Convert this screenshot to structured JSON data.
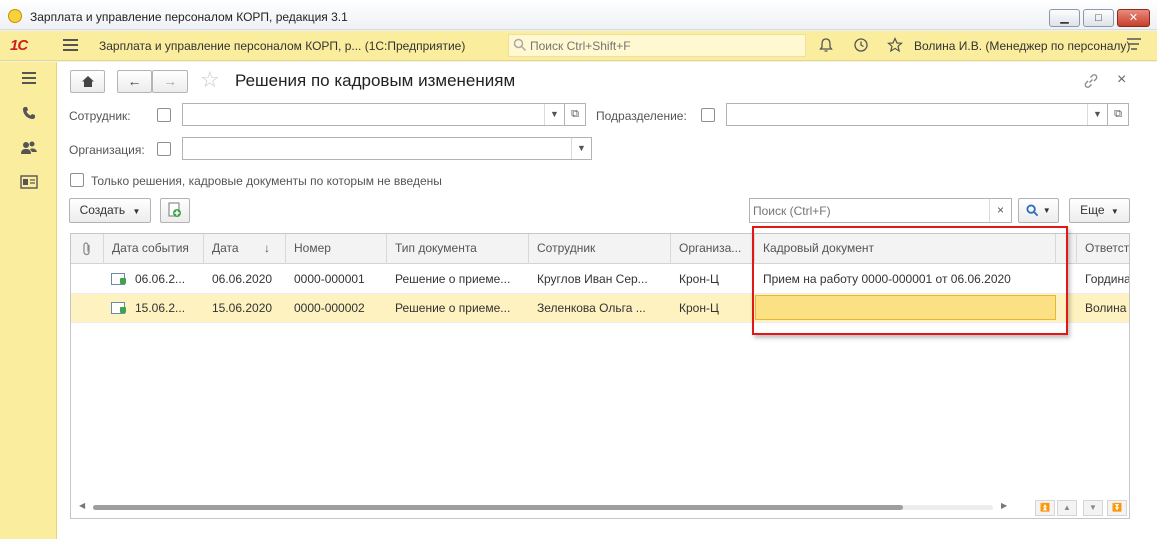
{
  "window": {
    "title": "Зарплата и управление персоналом КОРП, редакция 3.1",
    "btn_minimize": "▁",
    "btn_maximize": "□",
    "btn_close": "✕"
  },
  "topbar": {
    "logo": "1С",
    "app_title": "Зарплата и управление персоналом КОРП, р... (1С:Предприятие)",
    "search_placeholder": "Поиск Ctrl+Shift+F",
    "user": "Волина И.В. (Менеджер по персоналу)"
  },
  "form": {
    "title": "Решения по кадровым изменениям",
    "nav_home": "⌂",
    "nav_back": "←",
    "nav_forward": "→",
    "favorite": "☆",
    "link": "🔗",
    "close": "×"
  },
  "filters": {
    "employee_label": "Сотрудник:",
    "employee_value": "",
    "department_label": "Подразделение:",
    "department_value": "",
    "organization_label": "Организация:",
    "organization_value": "",
    "only_decisions_label": "Только решения, кадровые документы по которым не введены"
  },
  "toolbar": {
    "create_label": "Создать",
    "search_placeholder": "Поиск (Ctrl+F)",
    "more_label": "Еще"
  },
  "table": {
    "columns": [
      "Дата события",
      "Дата",
      "↓",
      "Номер",
      "Тип документа",
      "Сотрудник",
      "Организа...",
      "Кадровый документ",
      "Ответст"
    ],
    "rows": [
      {
        "event_date": "06.06.2...",
        "date": "06.06.2020",
        "number": "0000-000001",
        "doc_type": "Решение о приеме...",
        "employee": "Круглов Иван Сер...",
        "organization": "Крон-Ц",
        "hr_document": "Прием на работу 0000-000001 от 06.06.2020",
        "responsible": "Гордина"
      },
      {
        "event_date": "15.06.2...",
        "date": "15.06.2020",
        "number": "0000-000002",
        "doc_type": "Решение о приеме...",
        "employee": "Зеленкова Ольга ...",
        "organization": "Крон-Ц",
        "hr_document": "",
        "responsible": "Волина"
      }
    ],
    "selected_row": 2
  },
  "colors": {
    "accent_yellow": "#fbed9e",
    "highlight_red": "#e01818",
    "selected_row": "#fdf2c0",
    "focused_cell": "#fce084"
  }
}
